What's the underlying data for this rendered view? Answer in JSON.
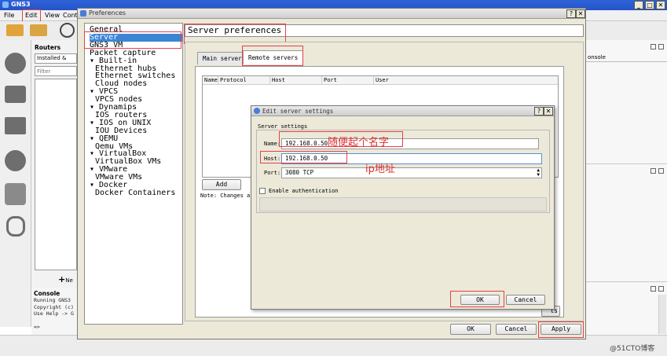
{
  "app": {
    "title": "GNS3"
  },
  "menu": {
    "file": "File",
    "edit": "Edit",
    "view": "View",
    "control_partial": "Cont"
  },
  "left_dock": {
    "routers_title": "Routers",
    "installed_filter": "Installed &",
    "filter_placeholder": "Filter",
    "new_partial": "Ne"
  },
  "console": {
    "title": "Console",
    "lines": [
      "Running GNS3",
      "Copyright (c)",
      "Use Help -> G",
      "=>"
    ]
  },
  "right_dock": {
    "console_partial": "onsole"
  },
  "preferences": {
    "title": "Preferences",
    "tree": [
      {
        "label": "General",
        "indent": 0
      },
      {
        "label": "Server",
        "indent": 0,
        "selected": true
      },
      {
        "label": "GNS3 VM",
        "indent": 0
      },
      {
        "label": "Packet capture",
        "indent": 0
      },
      {
        "label": "▾ Built-in",
        "indent": 0
      },
      {
        "label": "Ethernet hubs",
        "indent": 1
      },
      {
        "label": "Ethernet switches",
        "indent": 1
      },
      {
        "label": "Cloud nodes",
        "indent": 1
      },
      {
        "label": "▾ VPCS",
        "indent": 0
      },
      {
        "label": "VPCS nodes",
        "indent": 1
      },
      {
        "label": "▾ Dynamips",
        "indent": 0
      },
      {
        "label": "IOS routers",
        "indent": 1
      },
      {
        "label": "▾ IOS on UNIX",
        "indent": 0
      },
      {
        "label": "IOU Devices",
        "indent": 1
      },
      {
        "label": "▾ QEMU",
        "indent": 0
      },
      {
        "label": "Qemu VMs",
        "indent": 1
      },
      {
        "label": "▾ VirtualBox",
        "indent": 0
      },
      {
        "label": "VirtualBox VMs",
        "indent": 1
      },
      {
        "label": "▾ VMware",
        "indent": 0
      },
      {
        "label": "VMware VMs",
        "indent": 1
      },
      {
        "label": "▾ Docker",
        "indent": 0
      },
      {
        "label": "Docker Containers",
        "indent": 1
      }
    ],
    "page_title": "Server preferences",
    "tabs": {
      "main": "Main server",
      "remote": "Remote servers"
    },
    "columns": [
      "Name",
      "Protocol",
      "Host",
      "Port",
      "User"
    ],
    "add_button": "Add",
    "note": "Note: Changes ar",
    "hidden_button_tail": "ts",
    "ok": "OK",
    "cancel": "Cancel",
    "apply": "Apply"
  },
  "edit_server": {
    "title": "Edit server settings",
    "group": "Server settings",
    "name_label": "Name:",
    "name_value": "192.168.0.50",
    "host_label": "Host:",
    "host_value": "192.168.0.50",
    "port_label": "Port:",
    "port_value": "3080 TCP",
    "auth_label": "Enable authentication",
    "ok": "OK",
    "cancel": "Cancel"
  },
  "annotations": {
    "name_note": "随便起个名字",
    "host_note": "ip地址"
  },
  "watermark": "@51CTO博客",
  "colors": {
    "selection": "#3a85d4",
    "annotation": "#e5404b",
    "titlebar": "#2454c8"
  }
}
